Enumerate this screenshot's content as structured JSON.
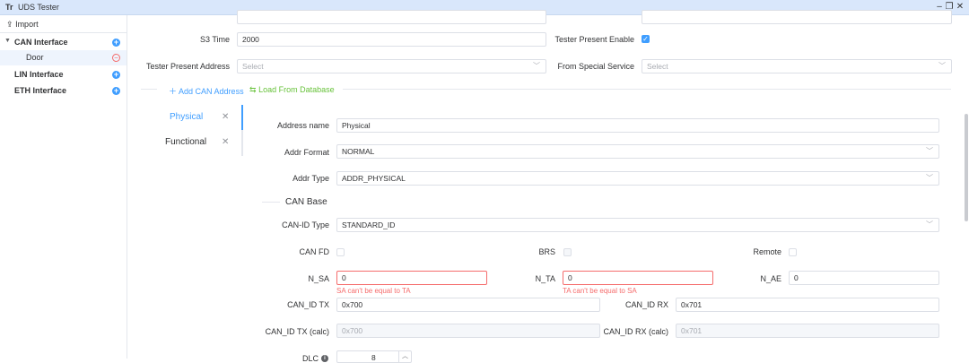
{
  "window": {
    "title": "UDS Tester",
    "logo": "Tr"
  },
  "sidebar": {
    "import_label": "Import",
    "items": [
      {
        "label": "CAN Interface",
        "expanded": true
      },
      {
        "label": "Door",
        "child": true
      },
      {
        "label": "LIN Interface"
      },
      {
        "label": "ETH Interface"
      }
    ]
  },
  "form": {
    "s3_time": {
      "label": "S3 Time",
      "value": "2000"
    },
    "tester_present_enable": {
      "label": "Tester Present Enable",
      "checked": true
    },
    "tester_present_address": {
      "label": "Tester Present Address",
      "placeholder": "Select"
    },
    "from_special_service": {
      "label": "From Special Service",
      "placeholder": "Select"
    }
  },
  "actions": {
    "add_can_address": "Add CAN Address",
    "load_from_database": "Load From Database"
  },
  "tabs": [
    {
      "label": "Physical",
      "active": true
    },
    {
      "label": "Functional"
    }
  ],
  "address": {
    "address_name": {
      "label": "Address name",
      "value": "Physical"
    },
    "addr_format": {
      "label": "Addr Format",
      "value": "NORMAL"
    },
    "addr_type": {
      "label": "Addr Type",
      "value": "ADDR_PHYSICAL"
    },
    "can_base_title": "CAN Base",
    "can_id_type": {
      "label": "CAN-ID Type",
      "value": "STANDARD_ID"
    },
    "can_fd": {
      "label": "CAN FD"
    },
    "brs": {
      "label": "BRS"
    },
    "remote": {
      "label": "Remote"
    },
    "n_sa": {
      "label": "N_SA",
      "value": "0",
      "error": "SA can't be equal to TA"
    },
    "n_ta": {
      "label": "N_TA",
      "value": "0",
      "error": "TA can't be equal to SA"
    },
    "n_ae": {
      "label": "N_AE",
      "value": "0"
    },
    "can_id_tx": {
      "label": "CAN_ID TX",
      "value": "0x700"
    },
    "can_id_rx": {
      "label": "CAN_ID RX",
      "value": "0x701"
    },
    "can_id_tx_calc": {
      "label": "CAN_ID TX (calc)",
      "value": "0x700"
    },
    "can_id_rx_calc": {
      "label": "CAN_ID RX (calc)",
      "value": "0x701"
    },
    "dlc": {
      "label": "DLC",
      "value": "8"
    }
  },
  "colors": {
    "accent": "#409eff",
    "error": "#f56c6c",
    "success": "#67c23a",
    "titlebar": "#d9e7fb"
  }
}
